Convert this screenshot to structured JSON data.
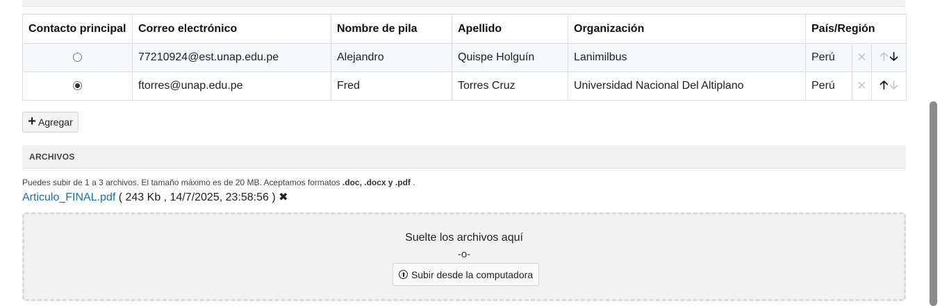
{
  "contacts_table": {
    "headers": [
      "Contacto principal",
      "Correo electrónico",
      "Nombre de pila",
      "Apellido",
      "Organización",
      "País/Región"
    ],
    "rows": [
      {
        "primary": false,
        "email": "77210924@est.unap.edu.pe",
        "first_name": "Alejandro",
        "last_name": "Quispe Holguín",
        "organization": "Lanimilbus",
        "country": "Perú",
        "remove_icon": "✕",
        "up_arrow": "🡡",
        "down_arrow": "🡣",
        "up_enabled": false,
        "down_enabled": true
      },
      {
        "primary": true,
        "email": "ftorres@unap.edu.pe",
        "first_name": "Fred",
        "last_name": "Torres Cruz",
        "organization": "Universidad Nacional Del Altiplano",
        "country": "Perú",
        "remove_icon": "✕",
        "up_arrow": "🡡",
        "down_arrow": "🡣",
        "up_enabled": true,
        "down_enabled": false
      }
    ]
  },
  "add_button": {
    "icon": "+",
    "label": "Agregar"
  },
  "files_section": {
    "title": "ARCHIVOS",
    "help_prefix": "Puedes subir de 1 a 3 archivos. El tamaño máximo es de 20 MB. Aceptamos formatos ",
    "help_formats": ".doc, .docx y .pdf",
    "help_suffix": " .",
    "file": {
      "name": "Articulo_FINAL.pdf",
      "meta": " ( 243 Kb , 14/7/2025, 23:58:56 ) ",
      "remove_icon": "✖"
    },
    "dropzone": {
      "text": "Suelte los archivos aquí",
      "or": "-o-",
      "upload_label": "Subir desde la computadora"
    }
  },
  "icons": {
    "radio": "radio-icon",
    "remove": "close-icon",
    "up": "arrow-up-icon",
    "down": "arrow-down-icon",
    "upload": "upload-circle-icon"
  },
  "colors": {
    "link": "#1d6fa5",
    "row_highlight": "#f5f9fc",
    "section_bg": "#f2f2f2",
    "disabled_icon": "#c8c8c8"
  }
}
